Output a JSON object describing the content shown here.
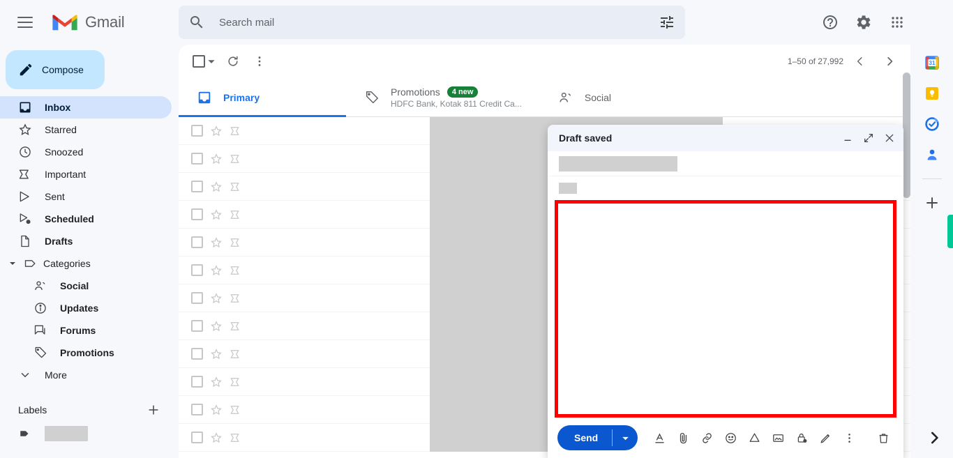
{
  "app": {
    "brand": "Gmail",
    "menu_icon": "hamburger-icon"
  },
  "search": {
    "placeholder": "Search mail",
    "value": "",
    "icon": "search-icon",
    "options_icon": "search-options-icon"
  },
  "top_actions": [
    {
      "name": "help-icon",
      "label": "Support"
    },
    {
      "name": "settings-icon",
      "label": "Settings"
    },
    {
      "name": "apps-grid-icon",
      "label": "Google apps"
    }
  ],
  "sidebar": {
    "compose_label": "Compose",
    "compose_icon": "pencil-icon",
    "items": [
      {
        "label": "Inbox",
        "icon": "inbox-icon",
        "active": true,
        "bold": true
      },
      {
        "label": "Starred",
        "icon": "star-icon",
        "active": false,
        "bold": false
      },
      {
        "label": "Snoozed",
        "icon": "clock-icon",
        "active": false,
        "bold": false
      },
      {
        "label": "Important",
        "icon": "important-icon",
        "active": false,
        "bold": false
      },
      {
        "label": "Sent",
        "icon": "send-icon",
        "active": false,
        "bold": false
      },
      {
        "label": "Scheduled",
        "icon": "scheduled-icon",
        "active": false,
        "bold": true
      },
      {
        "label": "Drafts",
        "icon": "draft-icon",
        "active": false,
        "bold": true
      }
    ],
    "categories": {
      "label": "Categories",
      "icon": "label-icon",
      "caret": "caret-down-icon"
    },
    "sub_items": [
      {
        "label": "Social",
        "icon": "people-icon"
      },
      {
        "label": "Updates",
        "icon": "info-icon"
      },
      {
        "label": "Forums",
        "icon": "forum-icon"
      },
      {
        "label": "Promotions",
        "icon": "tag-icon"
      }
    ],
    "more": {
      "label": "More",
      "icon": "caret-down-icon"
    },
    "labels_header": "Labels",
    "labels_add_icon": "plus-icon",
    "label_row_icon": "label-filled-icon"
  },
  "toolbar": {
    "select_all_icon": "checkbox-icon",
    "select_dropdown_icon": "caret-down-icon",
    "refresh_icon": "refresh-icon",
    "more_icon": "more-vertical-icon",
    "pagination": "1–50 of 27,992",
    "prev_icon": "chevron-left-icon",
    "next_icon": "chevron-right-icon"
  },
  "tabs": [
    {
      "label": "Primary",
      "icon": "inbox-tab-icon",
      "active": true,
      "badge": "",
      "sub": ""
    },
    {
      "label": "Promotions",
      "icon": "tag-tab-icon",
      "active": false,
      "badge": "4 new",
      "sub": "HDFC Bank, Kotak 811 Credit Ca..."
    },
    {
      "label": "Social",
      "icon": "people-tab-icon",
      "active": false,
      "badge": "",
      "sub": ""
    }
  ],
  "mail_rows": [
    {
      "checkbox": "checkbox-icon",
      "star": "star-icon",
      "important": "important-icon"
    },
    {
      "checkbox": "checkbox-icon",
      "star": "star-icon",
      "important": "important-icon"
    },
    {
      "checkbox": "checkbox-icon",
      "star": "star-icon",
      "important": "important-icon"
    },
    {
      "checkbox": "checkbox-icon",
      "star": "star-icon",
      "important": "important-icon"
    },
    {
      "checkbox": "checkbox-icon",
      "star": "star-icon",
      "important": "important-icon"
    },
    {
      "checkbox": "checkbox-icon",
      "star": "star-icon",
      "important": "important-icon"
    },
    {
      "checkbox": "checkbox-icon",
      "star": "star-icon",
      "important": "important-icon"
    },
    {
      "checkbox": "checkbox-icon",
      "star": "star-icon",
      "important": "important-icon"
    },
    {
      "checkbox": "checkbox-icon",
      "star": "star-icon",
      "important": "important-icon"
    },
    {
      "checkbox": "checkbox-icon",
      "star": "star-icon",
      "important": "important-icon"
    },
    {
      "checkbox": "checkbox-icon",
      "star": "star-icon",
      "important": "important-icon"
    },
    {
      "checkbox": "checkbox-icon",
      "star": "star-icon",
      "important": "important-icon"
    }
  ],
  "compose": {
    "title": "Draft saved",
    "minimize_icon": "minimize-icon",
    "expand_icon": "expand-icon",
    "close_icon": "close-icon",
    "to_value": "",
    "subject_value": "",
    "body_value": "",
    "send_label": "Send",
    "send_options_icon": "caret-down-icon",
    "tools": [
      {
        "name": "format-text-icon",
        "glyph": "A"
      },
      {
        "name": "attach-file-icon",
        "glyph": ""
      },
      {
        "name": "insert-link-icon",
        "glyph": ""
      },
      {
        "name": "insert-emoji-icon",
        "glyph": ""
      },
      {
        "name": "insert-drive-icon",
        "glyph": ""
      },
      {
        "name": "insert-photo-icon",
        "glyph": ""
      },
      {
        "name": "confidential-mode-icon",
        "glyph": ""
      },
      {
        "name": "insert-signature-icon",
        "glyph": ""
      },
      {
        "name": "more-options-icon",
        "glyph": ""
      }
    ],
    "discard_icon": "trash-icon"
  },
  "right_rail": {
    "items": [
      {
        "name": "google-calendar-icon",
        "label": "Calendar"
      },
      {
        "name": "google-keep-icon",
        "label": "Keep"
      },
      {
        "name": "google-tasks-icon",
        "label": "Tasks"
      },
      {
        "name": "google-contacts-icon",
        "label": "Contacts"
      }
    ],
    "add_icon": "plus-icon",
    "expand_icon": "chevron-right-icon"
  },
  "colors": {
    "accent_blue": "#1a73e8",
    "send_blue": "#0b57d0",
    "compose_chip": "#c2e7ff",
    "active_nav": "#d3e3fd",
    "badge_green": "#188038",
    "highlight_red": "#ff0000",
    "redaction_gray": "#d0d0d0",
    "rail_green": "#00c896"
  }
}
